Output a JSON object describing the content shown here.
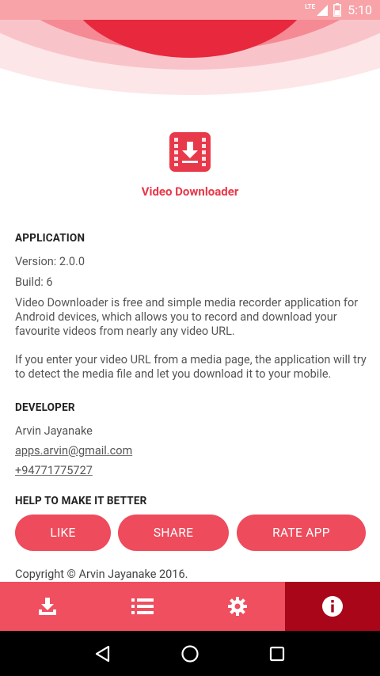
{
  "status_bar": {
    "network": "LTE",
    "time": "5:10"
  },
  "colors": {
    "accent": "#ee4b5c",
    "nav_active": "#a9061a",
    "title": "#e8394a"
  },
  "app": {
    "name": "Video Downloader",
    "logo_icon": "download-film-icon"
  },
  "application": {
    "title": "APPLICATION",
    "version": "Version: 2.0.0",
    "build": "Build: 6",
    "description1": "Video Downloader is free and simple media recorder application for Android devices, which allows you to record and download your favourite videos from nearly any video URL.",
    "description2": "If you enter your video URL from a media page, the application will try to detect the media file and let you download it to your mobile."
  },
  "developer": {
    "title": "DEVELOPER",
    "name": "Arvin Jayanake",
    "email": "apps.arvin@gmail.com",
    "phone": "+94771775727"
  },
  "help": {
    "title": "HELP TO MAKE IT BETTER",
    "buttons": [
      "LIKE",
      "SHARE",
      "RATE APP"
    ]
  },
  "copyright": "Copyright © Arvin Jayanake 2016.",
  "bottom_nav": {
    "items": [
      "download-icon",
      "list-icon",
      "settings-icon",
      "info-icon"
    ],
    "active": "info-icon"
  },
  "android_nav": [
    "back-icon",
    "home-icon",
    "recents-icon"
  ]
}
